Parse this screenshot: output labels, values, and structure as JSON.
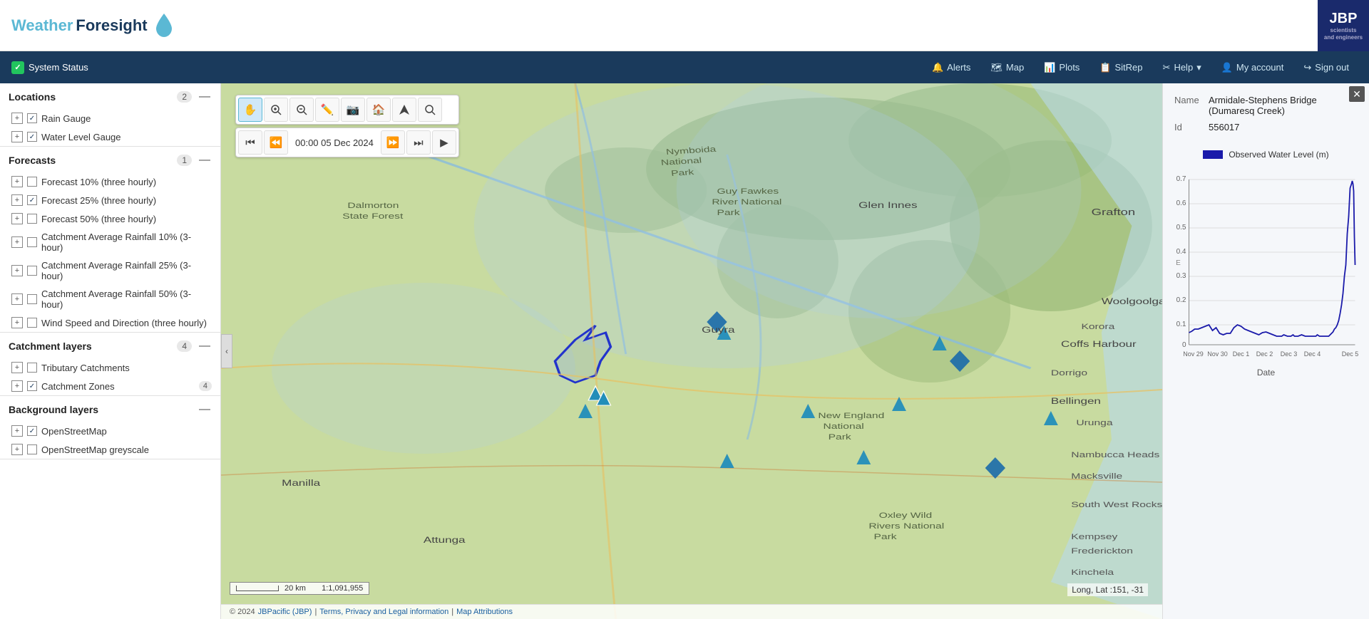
{
  "app": {
    "title_weather": "Weather",
    "title_foresight": "Foresight"
  },
  "header": {
    "jbp_label": "JBP",
    "jbp_subtitle": "scientists\nand engineers"
  },
  "navbar": {
    "status_label": "System Status",
    "alerts_label": "Alerts",
    "map_label": "Map",
    "plots_label": "Plots",
    "sitrep_label": "SitRep",
    "help_label": "Help",
    "my_account_label": "My account",
    "sign_out_label": "Sign out"
  },
  "sidebar": {
    "locations_label": "Locations",
    "locations_count": "2",
    "rain_gauge_label": "Rain Gauge",
    "water_level_gauge_label": "Water Level Gauge",
    "forecasts_label": "Forecasts",
    "forecasts_count": "1",
    "forecast_10_label": "Forecast 10% (three hourly)",
    "forecast_25_label": "Forecast 25% (three hourly)",
    "forecast_50_label": "Forecast 50% (three hourly)",
    "catchment_10_label": "Catchment Average Rainfall 10% (3-hour)",
    "catchment_25_label": "Catchment Average Rainfall 25% (3-hour)",
    "catchment_50_label": "Catchment Average Rainfall 50% (3-hour)",
    "wind_label": "Wind Speed and Direction (three hourly)",
    "catchment_layers_label": "Catchment layers",
    "catchment_layers_count": "4",
    "tributary_catchments_label": "Tributary Catchments",
    "catchment_zones_label": "Catchment Zones",
    "catchment_zones_count": "4",
    "background_label": "Background layers",
    "openstreetmap_label": "OpenStreetMap",
    "openstreetmap_grey_label": "OpenStreetMap greyscale"
  },
  "map_toolbar": {
    "btn_pan": "✋",
    "btn_zoom_in": "🔍",
    "btn_zoom_out": "🔎",
    "btn_draw": "✏️",
    "btn_camera": "📷",
    "btn_home": "🏠",
    "btn_locate": "➤",
    "btn_search": "🔍",
    "btn_first": "⏮",
    "btn_prev": "⏪",
    "btn_time": "00:00 05 Dec 2024",
    "btn_next": "⏩",
    "btn_last": "⏭",
    "btn_play": "▶"
  },
  "map_info": {
    "scale_label": "20 km",
    "scale_ratio": "1:1,091,955",
    "coords": "Long, Lat :151, -31"
  },
  "attribution": {
    "year": "© 2024",
    "company": "JBPacific (JBP)",
    "sep1": "|",
    "terms": "Terms, Privacy and Legal information",
    "sep2": "|",
    "map_attr": "Map Attributions"
  },
  "right_panel": {
    "name_label": "Name",
    "name_value": "Armidale-Stephens Bridge (Dumaresq Creek)",
    "id_label": "Id",
    "id_value": "556017",
    "chart_legend": "Observed Water Level (m)",
    "chart_x_label": "Date",
    "chart_dates": [
      "Nov 29",
      "Nov 30",
      "Dec 1",
      "Dec 2",
      "Dec 3",
      "Dec 4",
      "Dec 5"
    ],
    "chart_y_max": "0.7",
    "chart_y_values": [
      "0.7",
      "0.6",
      "0.5",
      "0.4",
      "0.3",
      "0.2",
      "0.1",
      "0"
    ]
  },
  "map_labels": {
    "grafton": "Grafton",
    "glen_innes": "Glen Innes",
    "coffs_harbour": "Coffs Harbour",
    "bellingen": "Bellingen",
    "dorrigo": "Dorrigo",
    "korora": "Korora",
    "manilla": "Manilla",
    "guyra": "Guyra",
    "woolgoolga": "Woolgoolga",
    "urunga": "Urunga",
    "nambucca_heads": "Nambucca Heads",
    "macksville": "Macksville",
    "south_west_rocks": "South West Rocks",
    "kempsey": "Kempsey",
    "frederickton": "Frederickton",
    "kinchela": "Kinchela",
    "attunga": "Attunga"
  }
}
